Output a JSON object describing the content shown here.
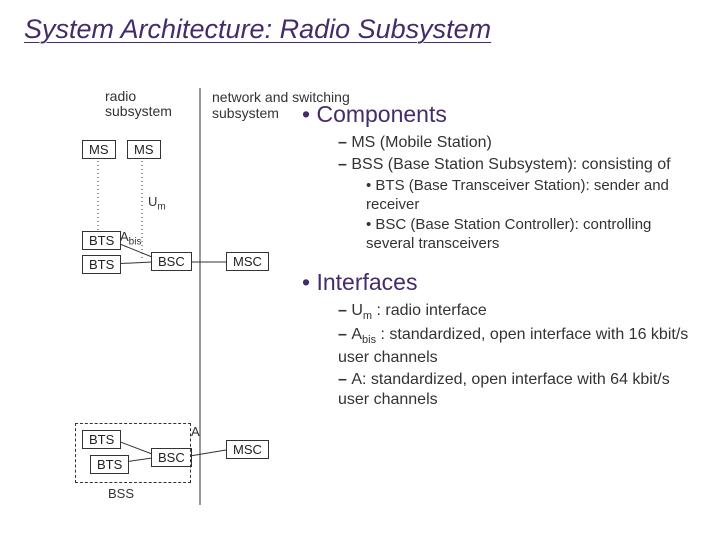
{
  "title": "System Architecture: Radio Subsystem",
  "diagram": {
    "labels": {
      "radio_sub": "radio subsystem",
      "net_sub": "network and switching subsystem",
      "ms": "MS",
      "bts": "BTS",
      "bsc": "BSC",
      "msc": "MSC",
      "bss": "BSS",
      "um_pre": "U",
      "um_sub": "m",
      "abis_pre": "A",
      "abis_sub": "bis",
      "a": "A"
    }
  },
  "bullets": {
    "b1": "Components",
    "b1_items": {
      "i1": "MS (Mobile Station)",
      "i2_pre": "BSS (Base Station Subsystem): consisting of",
      "i2_sub": {
        "s1": "BTS (Base Transceiver Station): sender and receiver",
        "s2": "BSC (Base Station Controller): controlling several transceivers"
      }
    },
    "b2": "Interfaces",
    "b2_items": {
      "i1_pre": "U",
      "i1_sub": "m",
      "i1_post": " : radio interface",
      "i2_pre": "A",
      "i2_sub": "bis",
      "i2_post": " : standardized, open interface with 16 kbit/s user channels",
      "i3": "A: standardized, open interface with 64 kbit/s user channels"
    }
  }
}
